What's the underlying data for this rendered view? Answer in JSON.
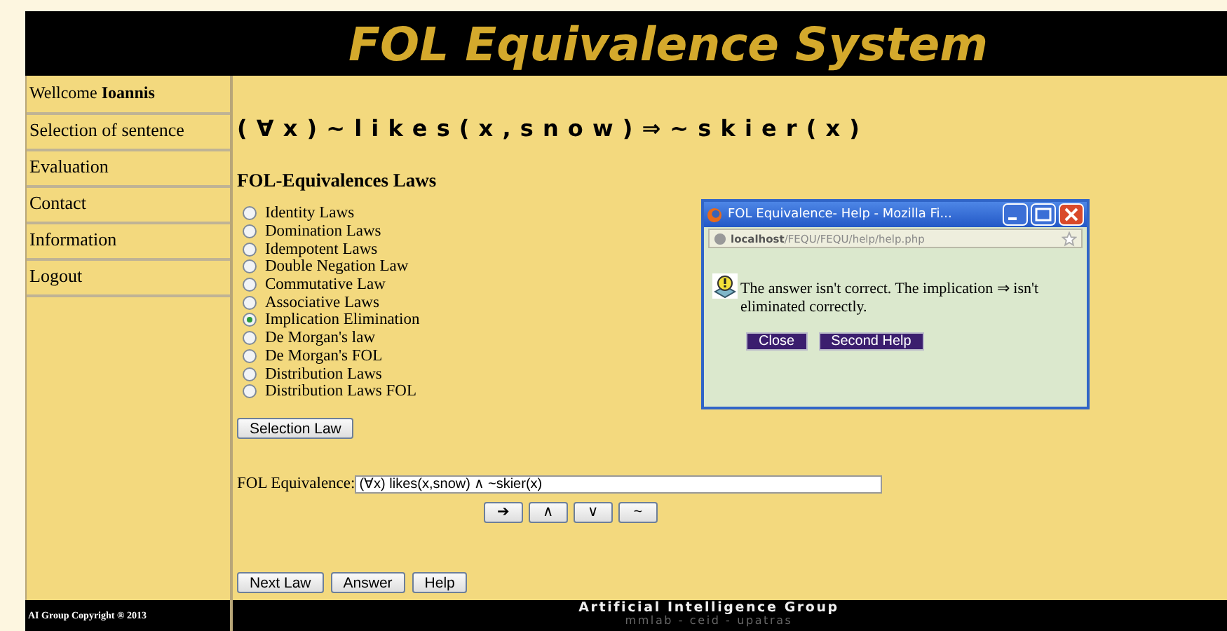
{
  "header": {
    "title": "FOL Equivalence System"
  },
  "sidebar": {
    "welcome": "Wellcome **Ioannis**",
    "items": [
      {
        "label": "Selection of sentence"
      },
      {
        "label": "Evaluation"
      },
      {
        "label": "Contact"
      },
      {
        "label": "Information"
      },
      {
        "label": "Logout"
      }
    ],
    "copyright": "AI Group Copyright ® 2013"
  },
  "sentence": "( ∀ x ) ~ l i k e s ( x , s n o w ) ⇒ ~ s k i e r ( x )",
  "laws": {
    "heading": "FOL-Equivalences Laws",
    "options": [
      {
        "label": "Identity Laws",
        "selected": false
      },
      {
        "label": "Domination Laws",
        "selected": false
      },
      {
        "label": "Idempotent Laws",
        "selected": false
      },
      {
        "label": "Double Negation Law",
        "selected": false
      },
      {
        "label": "Commutative Law",
        "selected": false
      },
      {
        "label": "Associative Laws",
        "selected": false
      },
      {
        "label": "Implication Elimination",
        "selected": true
      },
      {
        "label": "De Morgan's law",
        "selected": false
      },
      {
        "label": "De Morgan's FOL",
        "selected": false
      },
      {
        "label": "Distribution Laws",
        "selected": false
      },
      {
        "label": "Distribution Laws FOL",
        "selected": false
      }
    ],
    "button": "Selection Law"
  },
  "equivalence": {
    "label": "FOL Equivalence:",
    "value": "(∀x) likes(x,snow) ∧ ~skier(x)",
    "symbols": [
      "➔",
      "∧",
      "∨",
      "~"
    ]
  },
  "actions": [
    "Next Law",
    "Answer",
    "Help"
  ],
  "footer": {
    "title": "Artificial Intelligence Group",
    "subtitle": "mmlab - ceid - upatras"
  },
  "popup": {
    "title": "FOL Equivalence- Help - Mozilla Fi...",
    "url_host": "localhost",
    "url_path": "/FEQU/FEQU/help/help.php",
    "message": "The answer isn't correct. The implication ⇒ isn't eliminated correctly.",
    "buttons": [
      "Close",
      "Second Help"
    ]
  }
}
